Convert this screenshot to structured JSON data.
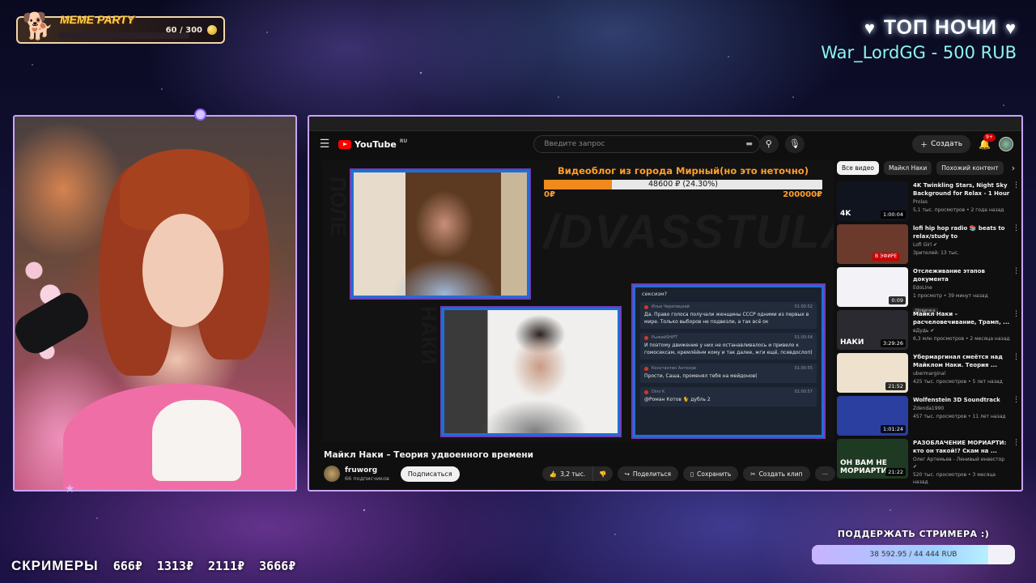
{
  "overlay": {
    "meme": {
      "title": "MEME PARTY",
      "count": "60 / 300",
      "progress": 0.2,
      "icon": "doge-icon",
      "coin_icon": "coin-icon"
    },
    "top_donation": {
      "title": "ТОП НОЧИ",
      "donor": "War_LordGG - 500 RUB"
    },
    "screamers": {
      "title": "СКРИМЕРЫ",
      "prices": [
        "666₽",
        "1313₽",
        "2111₽",
        "3666₽"
      ]
    },
    "support": {
      "title": "ПОДДЕРЖАТЬ СТРИМЕРА :)",
      "progress_text": "38 592.95 / 44 444 RUB",
      "progress": 0.868
    },
    "colors": {
      "frame": "#c9a3ff",
      "donor": "#8ef5ef",
      "meme_title": "#ffd24a",
      "goal": "#ff9f2a"
    }
  },
  "youtube": {
    "logo": "YouTube",
    "logo_region": "RU",
    "search_placeholder": "Введите запрос",
    "create_label": "Создать",
    "notif_count": "9+",
    "video": {
      "watermark": "/DVASSTULA",
      "side_text": "ПОЛЕ",
      "side_text2": "НАКИ",
      "goal_title": "Видеоблог из города Мирный(но это неточно)",
      "goal_text": "48600 ₽ (24.30%)",
      "goal_progress": 0.243,
      "goal_min": "0₽",
      "goal_max": "200000₽",
      "chat_top": "сексизм?",
      "chat": [
        {
          "user": "Ильи Черепицкий",
          "time": "01:00:52",
          "text": "Да. Право голоса получали женщины СССР одними из первых в мире. Только выборов не подвезли, а так всё ок"
        },
        {
          "user": "РыжийSHIFT",
          "time": "01:00:54",
          "text": "И поэтому движение у них не останавливалось и привело к гомосексам, кремлёйнм кому и так далее, жги ещё, псевдослоп)"
        },
        {
          "user": "Константин Антонов",
          "time": "01:00:55",
          "text": "Прости, Саша, променял тебя на мейдонов("
        },
        {
          "user": "Dino K",
          "time": "01:00:57",
          "text": "@Роман Котов 🐈 дубль 2"
        }
      ]
    },
    "video_title": "Майкл Наки – Теория удвоенного времени",
    "channel": {
      "name": "fruworg",
      "subs": "66 подписчиков",
      "subscribe": "Подписаться"
    },
    "actions": {
      "likes": "3,2 тыс.",
      "share": "Поделиться",
      "save": "Сохранить",
      "clip": "Создать клип",
      "more": "⋯"
    },
    "chips": [
      "Все видео",
      "Майкл Наки",
      "Похожий контент"
    ],
    "recommendations": [
      {
        "title": "4K Twinkling Stars, Night Sky Background for Relax - 1 Hour ...",
        "channel": "Prolas",
        "meta": "5,1 тыс. просмотров • 2 года назад",
        "duration": "1:00:04",
        "thumb": "#10141e",
        "badge": "4K"
      },
      {
        "title": "lofi hip hop radio 📚 beats to relax/study to",
        "channel": "Lofi Girl ✔",
        "meta": "Зрителей: 13 тыс.",
        "live": "В ЭФИРЕ",
        "thumb": "#6b3a2c"
      },
      {
        "title": "Отслеживание этапов документа",
        "channel": "EdoLine",
        "meta": "1 просмотр • 39 минут назад",
        "duration": "0:09",
        "new": "Новинка",
        "thumb": "#f2f2f7"
      },
      {
        "title": "Майкл Наки – расчеловечивание, Трамп, ...",
        "channel": "вДудь ✔",
        "meta": "6,3 млн просмотров • 2 месяца назад",
        "duration": "3:29:26",
        "badge": "НАКИ",
        "thumb": "#2a2a30"
      },
      {
        "title": "Убермаргинал смеётся над Майклом Наки. Теория ...",
        "channel": "ubermarginal",
        "meta": "425 тыс. просмотров • 5 лет назад",
        "duration": "21:52",
        "thumb": "#eee2cf"
      },
      {
        "title": "Wolfenstein 3D Soundtrack",
        "channel": "Zdenda1990",
        "meta": "457 тыс. просмотров • 11 лет назад",
        "duration": "1:01:24",
        "thumb": "#2b3fa0"
      },
      {
        "title": "РАЗОБЛАЧЕНИЕ МОРИАРТИ: кто он такой!? Скам на ...",
        "channel": "Олег Артемьев - Ленивый инвестор ✔",
        "meta": "520 тыс. просмотров • 3 месяца назад",
        "duration": "21:22",
        "badge": "ОН ВАМ НЕ МОРИАРТИ",
        "thumb": "#1f3a22"
      }
    ]
  }
}
